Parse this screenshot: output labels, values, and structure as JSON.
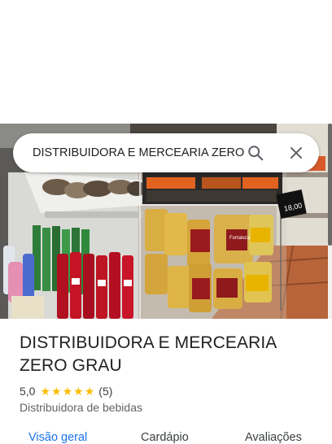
{
  "search": {
    "value": "DISTRIBUIDORA E MERCEARIA ZERO GRAU",
    "search_icon": "search-icon",
    "close_icon": "close-icon"
  },
  "place": {
    "name": "DISTRIBUIDORA E MERCEARIA ZERO GRAU",
    "rating": "5,0",
    "stars": 5,
    "review_count": "(5)",
    "category": "Distribuidora de bebidas"
  },
  "photo": {
    "price_tag": "18,00",
    "brand_label": "Fortaleza"
  },
  "tabs": [
    {
      "label": "Visão geral",
      "active": true
    },
    {
      "label": "Cardápio",
      "active": false
    },
    {
      "label": "Avaliações",
      "active": false
    }
  ],
  "colors": {
    "accent": "#1a73e8",
    "star": "#fbbc04"
  }
}
